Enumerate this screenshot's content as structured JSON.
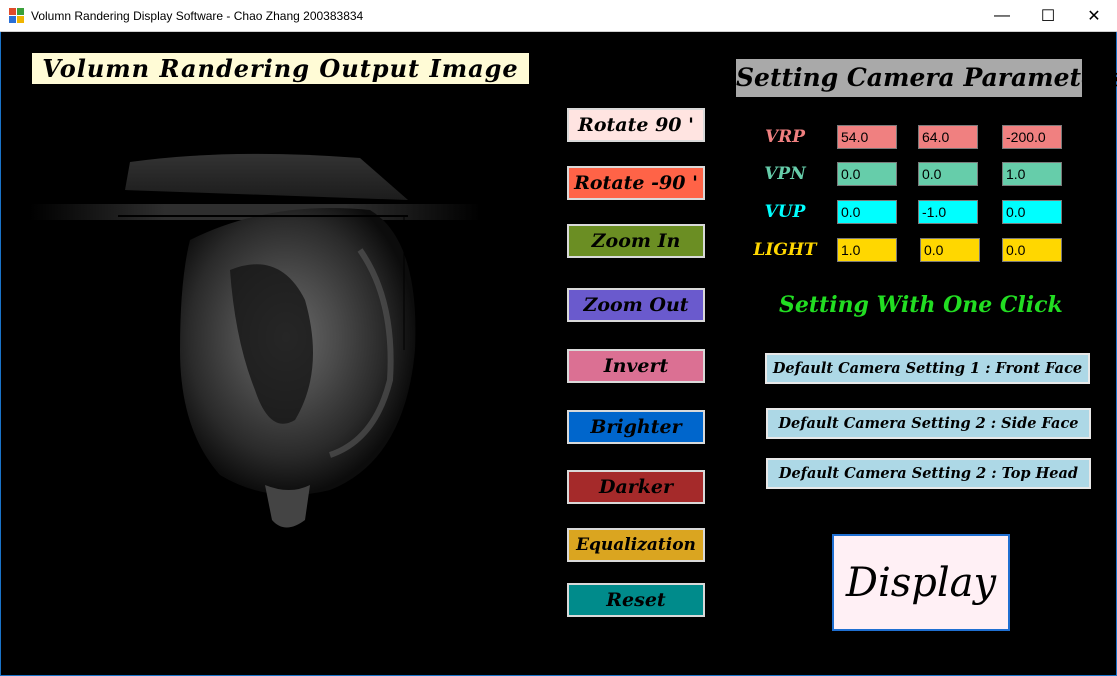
{
  "window": {
    "title": "Volumn Randering Display Software - Chao Zhang 200383834",
    "controls": {
      "minimize": "—",
      "maximize": "☐",
      "close": "✕"
    }
  },
  "output_panel": {
    "title": "Volumn Randering Output Image"
  },
  "image_buttons": [
    {
      "label": "Rotate 90 '",
      "color": "#ffe4e1"
    },
    {
      "label": "Rotate -90 '",
      "color": "#ff6347"
    },
    {
      "label": "Zoom In",
      "color": "#6b8e23"
    },
    {
      "label": "Zoom Out",
      "color": "#6a5acd"
    },
    {
      "label": "Invert",
      "color": "#db7093"
    },
    {
      "label": "Brighter",
      "color": "#0066cc"
    },
    {
      "label": "Darker",
      "color": "#a52a2a"
    },
    {
      "label": "Equalization",
      "color": "#daa520"
    },
    {
      "label": "Reset",
      "color": "#008b8b"
    }
  ],
  "camera": {
    "title": "Setting Camera Parameters",
    "rows": [
      {
        "label": "VRP",
        "label_color": "#f08080",
        "field_color": "#f08080",
        "values": [
          "54.0",
          "64.0",
          "-200.0"
        ]
      },
      {
        "label": "VPN",
        "label_color": "#66cdaa",
        "field_color": "#66cdaa",
        "values": [
          "0.0",
          "0.0",
          "1.0"
        ]
      },
      {
        "label": "VUP",
        "label_color": "#00ffff",
        "field_color": "#00ffff",
        "values": [
          "0.0",
          "-1.0",
          "0.0"
        ]
      },
      {
        "label": "LIGHT",
        "label_color": "#ffd700",
        "field_color": "#ffd700",
        "values": [
          "1.0",
          "0.0",
          "0.0"
        ]
      }
    ]
  },
  "presets": {
    "title": "Setting With One Click",
    "items": [
      "Default Camera Setting 1 : Front Face",
      "Default Camera Setting 2 : Side Face",
      "Default Camera Setting 2 : Top Head"
    ]
  },
  "display_button": {
    "label": "Display"
  }
}
